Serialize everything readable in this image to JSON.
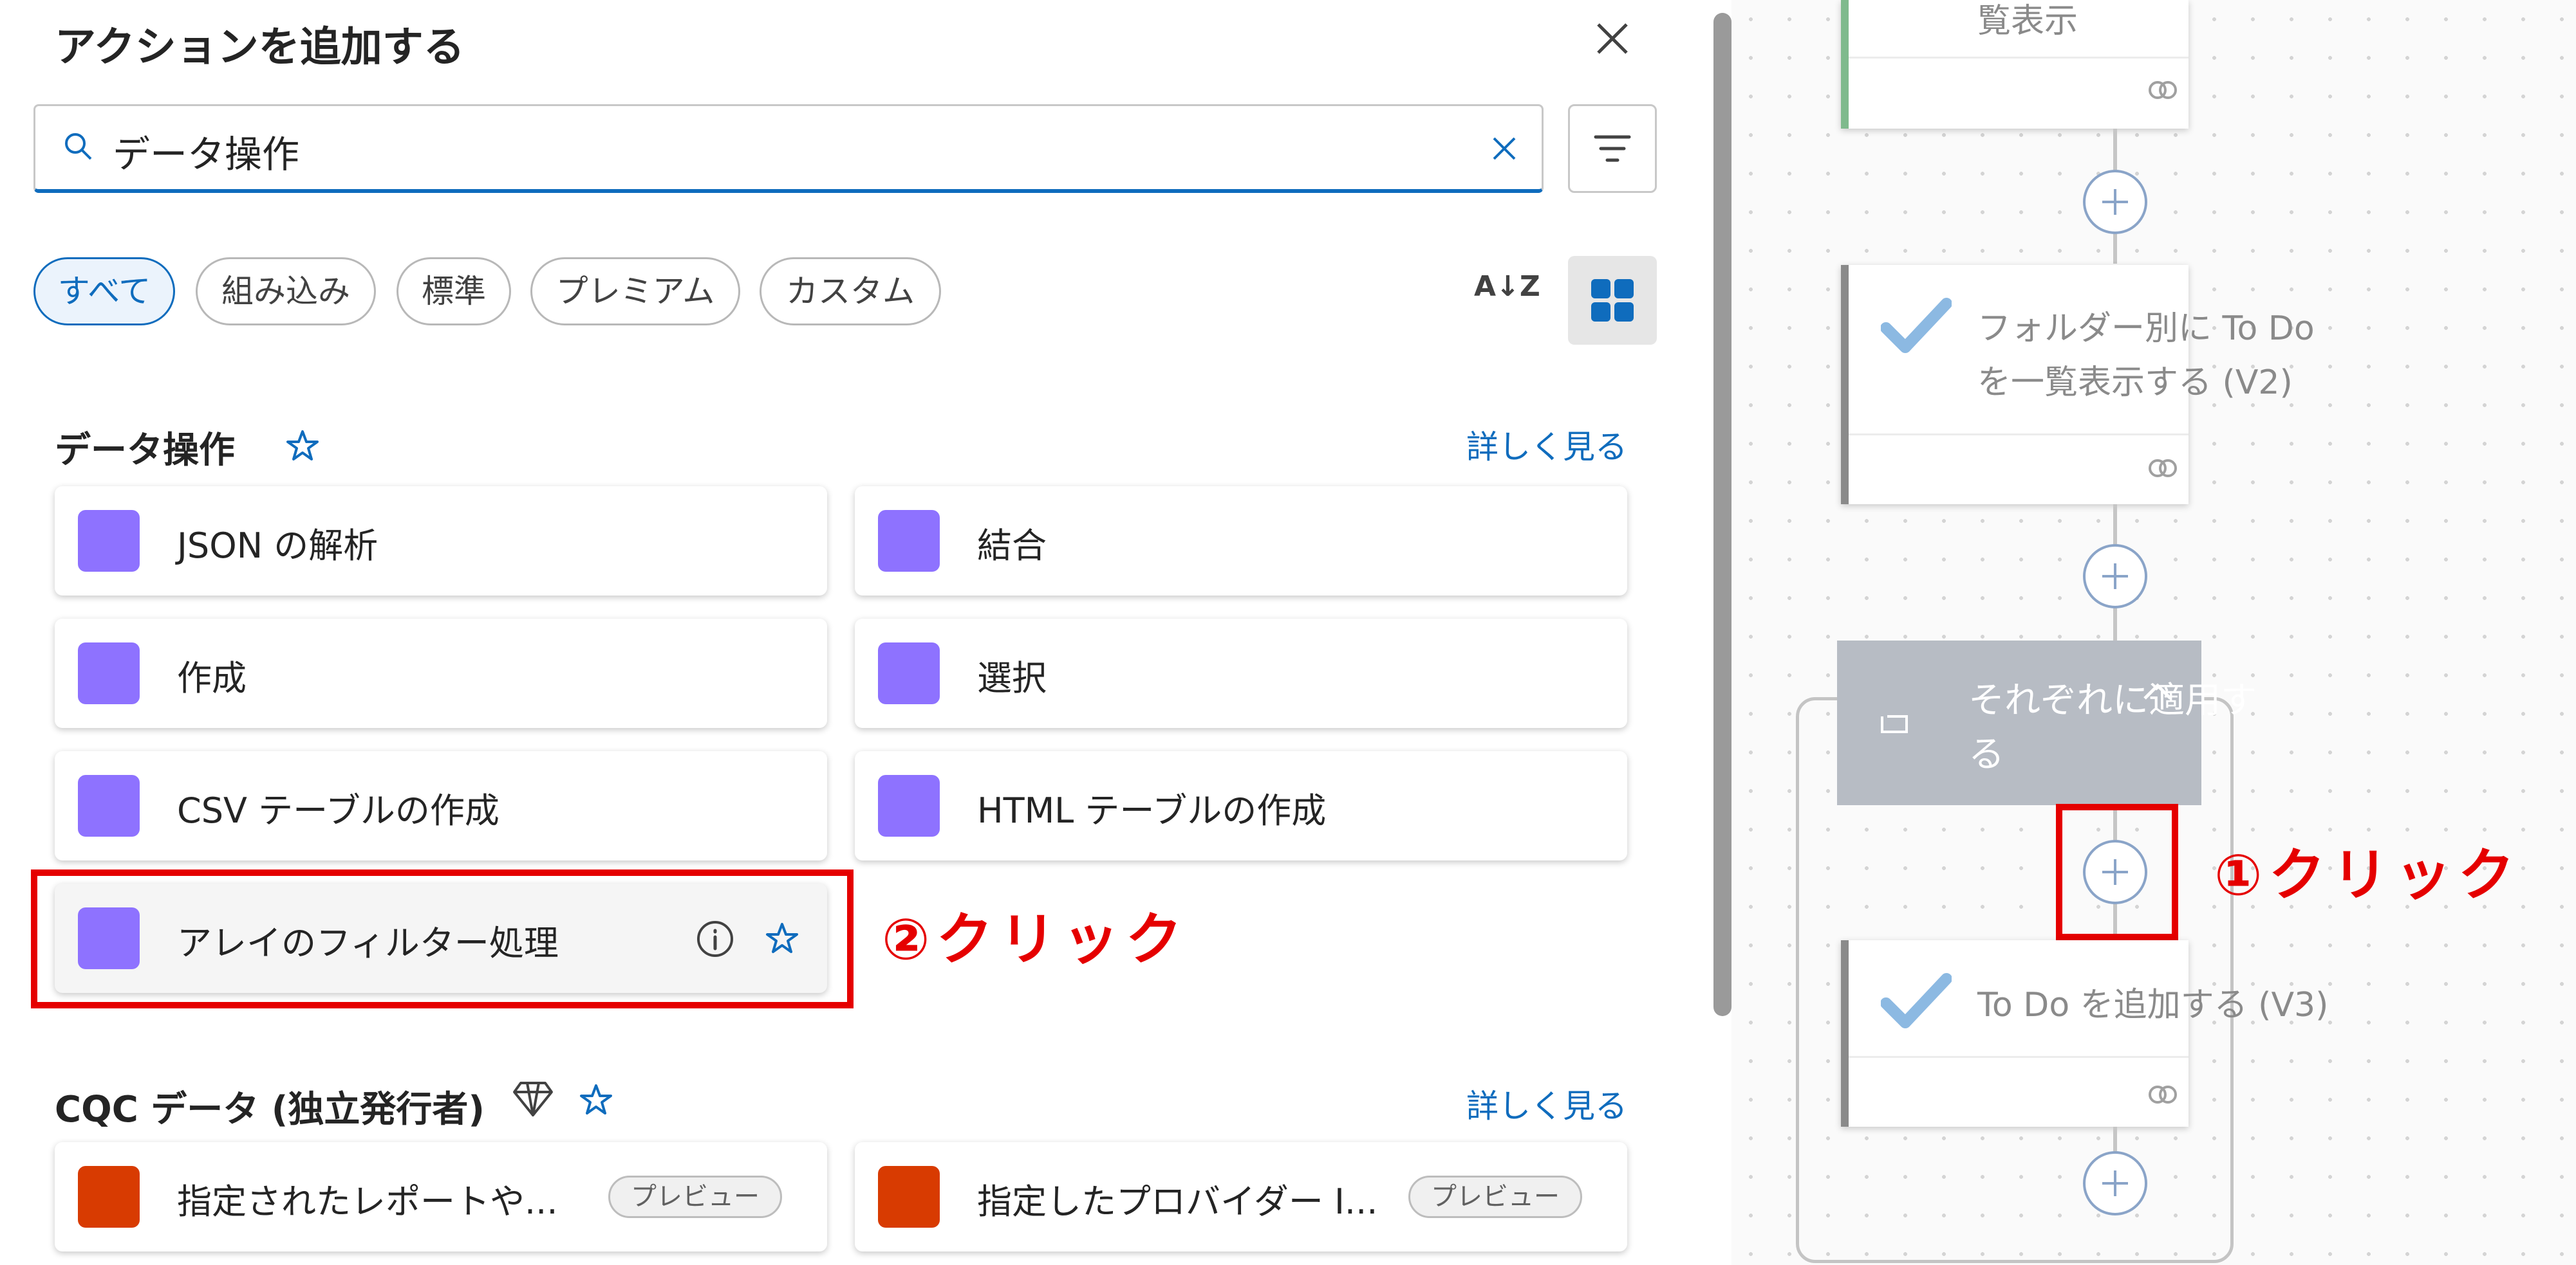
{
  "panel": {
    "title": "アクションを追加する",
    "search_value": "データ操作",
    "filters": [
      "すべて",
      "組み込み",
      "標準",
      "プレミアム",
      "カスタム"
    ],
    "sort_label": "A↓Z"
  },
  "section1": {
    "title": "データ操作",
    "more": "詳しく見る",
    "actions": [
      "JSON の解析",
      "結合",
      "作成",
      "選択",
      "CSV テーブルの作成",
      "HTML テーブルの作成",
      "アレイのフィルター処理"
    ]
  },
  "section2": {
    "title": "CQC データ (独立発行者)",
    "more": "詳しく見る",
    "actions": [
      "指定されたレポートや...",
      "指定したプロバイダー I..."
    ],
    "badge": "プレビュー"
  },
  "annotations": {
    "click1": "①クリック",
    "click2": "②クリック"
  },
  "flow": {
    "top_card_text": "覧表示",
    "card1": "フォルダー別に To Do を一覧表示する (V2)",
    "card1_line1": "フォルダー別に To Do",
    "card1_line2": "を一覧表示する (V2)",
    "loop_line1": "それぞれに適用す",
    "loop_line2": "る",
    "card2": "To Do を追加する (V3)"
  },
  "colors": {
    "accent": "#0f6cbd",
    "action_icon": "#8e72ff",
    "annotation_red": "#e50000",
    "cqc_icon": "#d83b01"
  }
}
